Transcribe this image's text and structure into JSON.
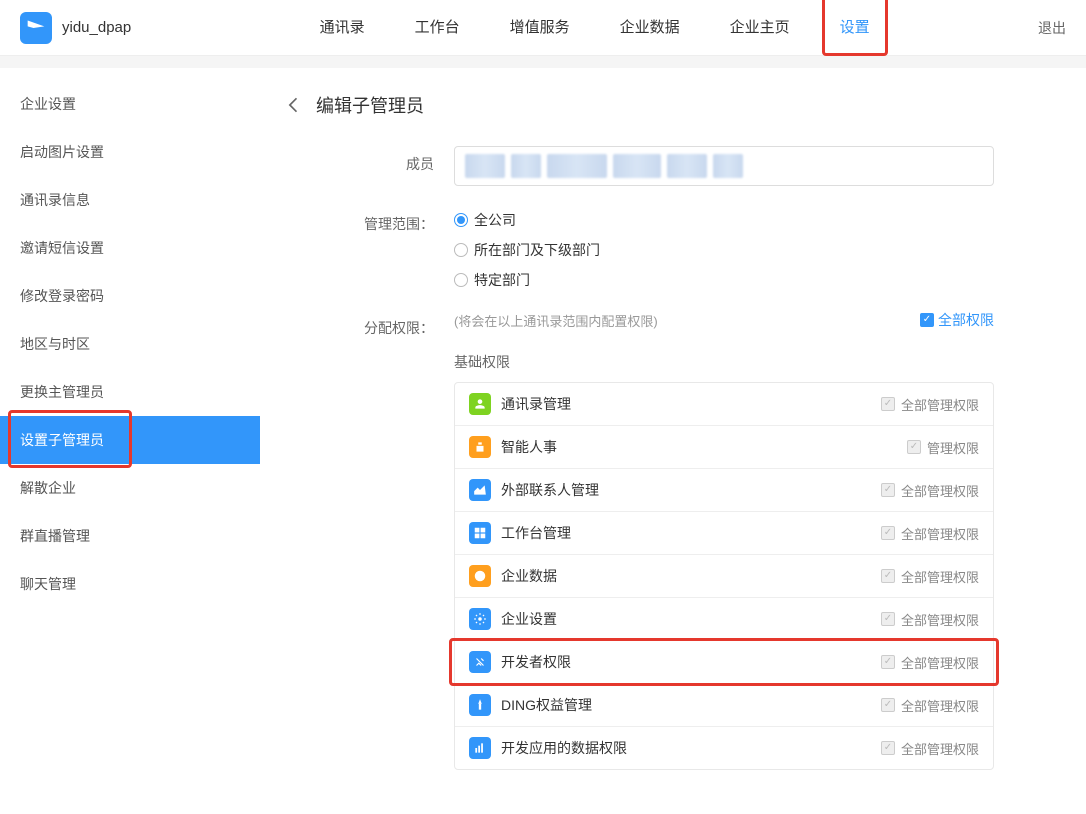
{
  "header": {
    "app_name": "yidu_dpap",
    "nav": [
      "通讯录",
      "工作台",
      "增值服务",
      "企业数据",
      "企业主页",
      "设置"
    ],
    "active_nav_index": 5,
    "logout": "退出"
  },
  "sidebar": {
    "items": [
      "企业设置",
      "启动图片设置",
      "通讯录信息",
      "邀请短信设置",
      "修改登录密码",
      "地区与时区",
      "更换主管理员",
      "设置子管理员",
      "解散企业",
      "群直播管理",
      "聊天管理"
    ],
    "active_index": 7
  },
  "page": {
    "title": "编辑子管理员",
    "member_label": "成员",
    "scope_label": "管理范围：",
    "scope_options": [
      "全公司",
      "所在部门及下级部门",
      "特定部门"
    ],
    "scope_selected_index": 0,
    "perm_label": "分配权限：",
    "perm_note": "(将会在以上通讯录范围内配置权限)",
    "all_perm_label": "全部权限",
    "section_title": "基础权限",
    "perms": [
      {
        "name": "通讯录管理",
        "right": "全部管理权限",
        "color": "#7ED321"
      },
      {
        "name": "智能人事",
        "right": "管理权限",
        "color": "#FF9F1E"
      },
      {
        "name": "外部联系人管理",
        "right": "全部管理权限",
        "color": "#3296FA"
      },
      {
        "name": "工作台管理",
        "right": "全部管理权限",
        "color": "#3296FA"
      },
      {
        "name": "企业数据",
        "right": "全部管理权限",
        "color": "#FF9F1E"
      },
      {
        "name": "企业设置",
        "right": "全部管理权限",
        "color": "#3296FA"
      },
      {
        "name": "开发者权限",
        "right": "全部管理权限",
        "color": "#3296FA"
      },
      {
        "name": "DING权益管理",
        "right": "全部管理权限",
        "color": "#3296FA"
      },
      {
        "name": "开发应用的数据权限",
        "right": "全部管理权限",
        "color": "#3296FA"
      }
    ],
    "highlight_perm_index": 6
  }
}
